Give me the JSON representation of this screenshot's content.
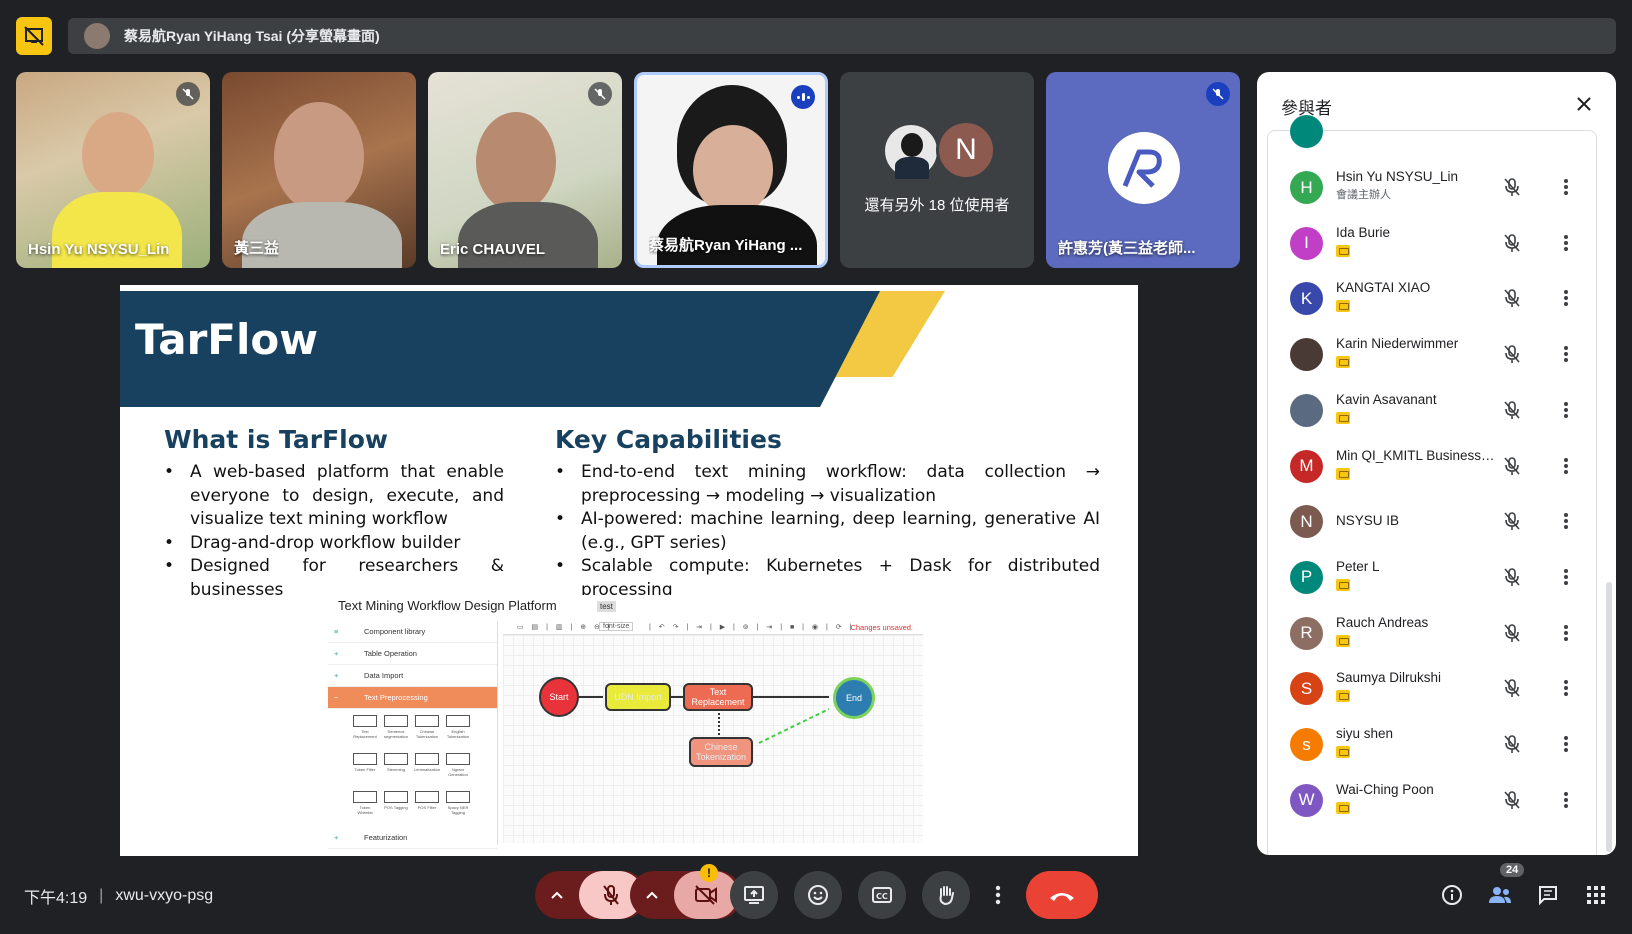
{
  "presenter_bar": {
    "text": "蔡易航Ryan YiHang Tsai (分享螢幕畫面)"
  },
  "tiles": [
    {
      "name": "Hsin Yu NSYSU_Lin"
    },
    {
      "name": "黃三益"
    },
    {
      "name": "Eric CHAUVEL"
    },
    {
      "name": "蔡易航Ryan YiHang ..."
    },
    {
      "name": "還有另外 18 位使用者",
      "avatar_letter": "N"
    },
    {
      "name": "許惠芳(黃三益老師..."
    }
  ],
  "slide": {
    "title": "TarFlow",
    "left_title": "What is TarFlow",
    "left_bullets": [
      "A web-based platform that enable everyone to design, execute, and visualize text mining workflow",
      "Drag-and-drop workflow builder",
      "Designed for researchers & businesses"
    ],
    "right_title": "Key Capabilities",
    "right_bullets": [
      "End-to-end text mining workflow: data collection → preprocessing → modeling → visualization",
      "AI-powered: machine learning, deep learning, generative AI (e.g., GPT series)",
      "Scalable compute: Kubernetes + Dask for distributed processing"
    ],
    "mockup": {
      "title": "Text Mining Workflow Design Platform",
      "tag": "test",
      "sidebar": [
        "Component library",
        "Table Operation",
        "Data Import",
        "Text Preprocessing",
        "Featurization"
      ],
      "grid_labels": [
        "Text Replacement",
        "Sentence segmentation",
        "Chinese Tokenization",
        "English Tokenization",
        "Token Filter",
        "Stemming",
        "Lemmatization",
        "Ngram Generation",
        "Token Whitelist",
        "POS Tagging",
        "POS Filter",
        "Spacy NER Tagging"
      ],
      "toolbar_field": "font-size",
      "unsaved": "Changes unsaved.",
      "nodes": [
        "Start",
        "UDN Import",
        "Text Replacement",
        "End",
        "Chinese Tokenization"
      ]
    }
  },
  "panel": {
    "title": "參與者",
    "participants": [
      {
        "letter": "H",
        "color": "#34a853",
        "name": "Hsin Yu NSYSU_Lin",
        "sub": "會議主辦人"
      },
      {
        "letter": "I",
        "color": "#c03fc6",
        "name": "Ida Burie",
        "sub": ""
      },
      {
        "letter": "K",
        "color": "#3949ab",
        "name": "KANGTAI XIAO",
        "sub": ""
      },
      {
        "letter": "",
        "color": "#4a3a36",
        "name": "Karin Niederwimmer",
        "sub": ""
      },
      {
        "letter": "",
        "color": "#5a6a80",
        "name": "Kavin Asavanant",
        "sub": ""
      },
      {
        "letter": "M",
        "color": "#c62828",
        "name": "Min QI_KMITL Business ...",
        "sub": ""
      },
      {
        "letter": "N",
        "color": "#7d5a50",
        "name": "NSYSU IB",
        "sub": ""
      },
      {
        "letter": "P",
        "color": "#00897b",
        "name": "Peter L",
        "sub": ""
      },
      {
        "letter": "R",
        "color": "#8d6e63",
        "name": "Rauch Andreas",
        "sub": ""
      },
      {
        "letter": "S",
        "color": "#d84315",
        "name": "Saumya Dilrukshi",
        "sub": ""
      },
      {
        "letter": "s",
        "color": "#f57c00",
        "name": "siyu shen",
        "sub": ""
      },
      {
        "letter": "W",
        "color": "#7e57c2",
        "name": "Wai-Ching Poon",
        "sub": ""
      }
    ]
  },
  "bottom": {
    "time": "下午4:19",
    "meeting_code": "xwu-vxyo-psg",
    "participant_count": "24",
    "warning": "!"
  }
}
